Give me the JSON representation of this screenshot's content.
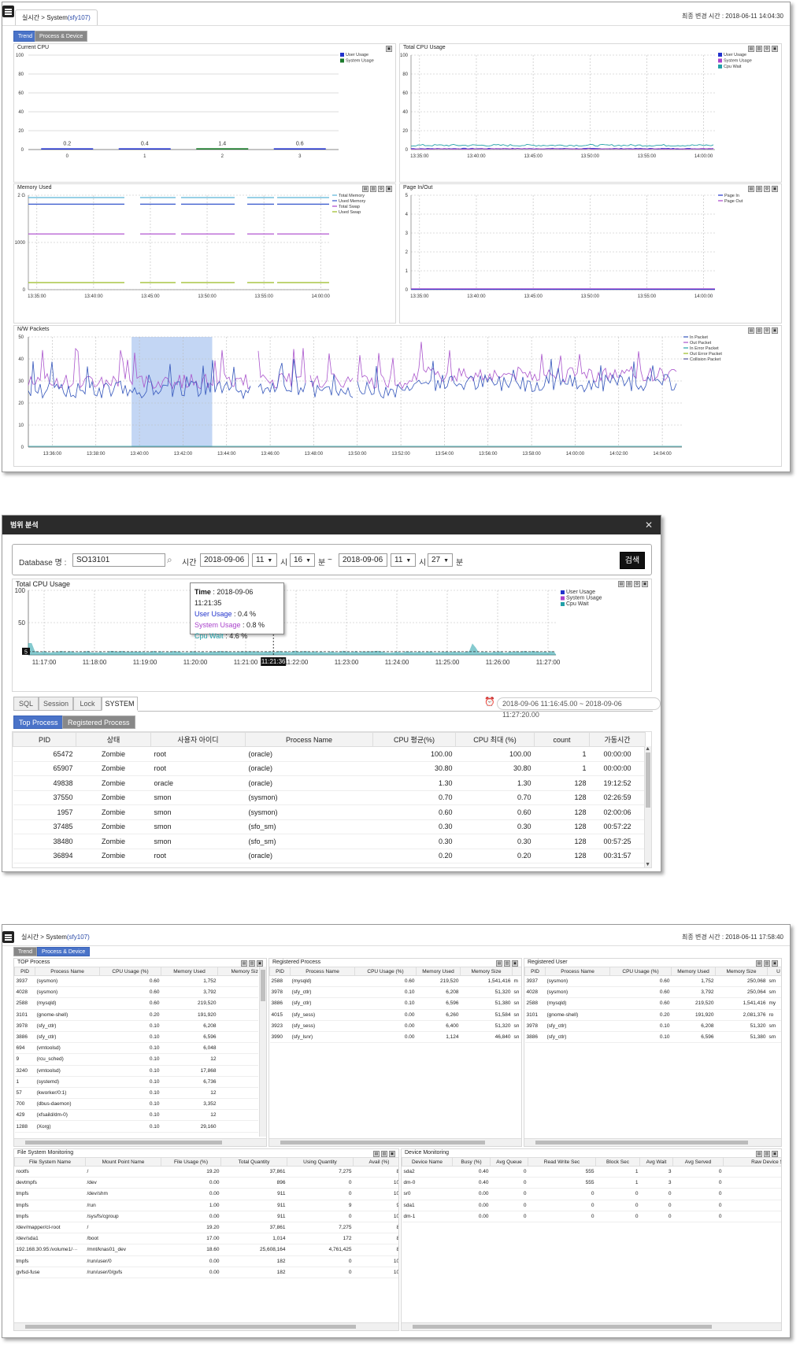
{
  "p1": {
    "breadcrumb": "실시간 > System",
    "server": "(sfy107)",
    "update_time": "최종 변경 시간 : 2018-06-11 14:04:30",
    "tabs": [
      "Trend",
      "Process & Device"
    ]
  },
  "charts1": {
    "current_cpu": {
      "type": "bar",
      "title": "Current CPU",
      "categories": [
        "0",
        "1",
        "2",
        "3"
      ],
      "series": [
        {
          "name": "User Usage",
          "values": [
            0.2,
            0.4,
            1.4,
            0.6
          ]
        },
        {
          "name": "System Usage",
          "values": [
            0,
            0,
            0,
            0
          ]
        }
      ],
      "data_labels": [
        "0.2",
        "0.4",
        "1.4",
        "0.6"
      ],
      "yticks": [
        "100",
        "80",
        "60",
        "40",
        "20",
        "0"
      ],
      "ylim": [
        0,
        100
      ],
      "legend": [
        "User Usage",
        "System Usage"
      ],
      "colors": [
        "#2233cc",
        "#1a7a2a"
      ]
    },
    "total_cpu": {
      "type": "line",
      "title": "Total CPU Usage",
      "yticks": [
        "100",
        "80",
        "60",
        "40",
        "20",
        "0"
      ],
      "xticks": [
        "13:35:00",
        "13:40:00",
        "13:45:00",
        "13:50:00",
        "13:55:00",
        "14:00:00"
      ],
      "legend": [
        "User Usage",
        "System Usage",
        "Cpu Wait"
      ],
      "colors": [
        "#2233cc",
        "#aa44cc",
        "#22a0a8"
      ],
      "ylim": [
        0,
        100
      ],
      "values_approx": [
        1,
        0.8,
        4.5
      ]
    },
    "memory": {
      "type": "line",
      "title": "Memory Used",
      "yticks": [
        "2 G",
        "1000",
        "0"
      ],
      "xticks": [
        "13:35:00",
        "13:40:00",
        "13:45:00",
        "13:50:00",
        "13:55:00",
        "14:00:00"
      ],
      "legend": [
        "Total Memory",
        "Used Memory",
        "Total Swap",
        "Used Swap"
      ],
      "colors": [
        "#5ab4d8",
        "#3355cc",
        "#aa44cc",
        "#99bb22"
      ],
      "values_approx": [
        1950,
        1810,
        1180,
        150
      ]
    },
    "page": {
      "type": "line",
      "title": "Page In/Out",
      "yticks": [
        "5",
        "4",
        "3",
        "2",
        "1",
        "0"
      ],
      "xticks": [
        "13:35:00",
        "13:40:00",
        "13:45:00",
        "13:50:00",
        "13:55:00",
        "14:00:00"
      ],
      "legend": [
        "Page In",
        "Page Out"
      ],
      "colors": [
        "#2233cc",
        "#aa44cc"
      ],
      "values_approx": [
        0,
        0
      ]
    },
    "nw": {
      "type": "line",
      "title": "N/W Packets",
      "yticks": [
        "50",
        "40",
        "30",
        "20",
        "10",
        "0"
      ],
      "xticks": [
        "13:36:00",
        "13:38:00",
        "13:40:00",
        "13:42:00",
        "13:44:00",
        "13:46:00",
        "13:48:00",
        "13:50:00",
        "13:52:00",
        "13:54:00",
        "13:56:00",
        "13:58:00",
        "14:00:00",
        "14:02:00",
        "14:04:00"
      ],
      "legend": [
        "In Packet",
        "Out Packet",
        "In Error Packet",
        "Out Error Packet",
        "Collision Packet"
      ],
      "colors": [
        "#3355bb",
        "#aa55cc",
        "#22a0a8",
        "#99bb22",
        "#555599"
      ],
      "ylim": [
        0,
        50
      ],
      "selection_range": [
        "13:40:00",
        "13:43:20"
      ]
    }
  },
  "p2": {
    "title": "범위 분석",
    "close": "✕",
    "db_label": "Database 명 :",
    "db_value": "SO13101",
    "time_label": "시간",
    "date_from": "2018-09-06",
    "hour_from": "11",
    "min_from": "16",
    "date_to": "2018-09-06",
    "hour_to": "11",
    "min_to": "27",
    "unit_h": "시",
    "unit_m": "분",
    "tilde": "~",
    "search_btn": "검색",
    "chart_title": "Total CPU Usage",
    "tooltip": {
      "time_label": "Time",
      "time": "2018-09-06 11:21:35",
      "user_label": "User Usage",
      "user": "0.4 %",
      "system_label": "System Usage",
      "system": "0.8 %",
      "wait_label": "Cpu Wait",
      "wait": "4.6 %"
    },
    "cursor_label": "11:21:36",
    "yticks": [
      "100",
      "50"
    ],
    "ymark": "5",
    "xticks": [
      "11:17:00",
      "11:18:00",
      "11:19:00",
      "11:20:00",
      "11:21:00",
      "11:22:00",
      "11:23:00",
      "11:24:00",
      "11:25:00",
      "11:26:00",
      "11:27:00"
    ],
    "legend": [
      "User Usage",
      "System Usage",
      "Cpu Wait"
    ],
    "colors": [
      "#2233cc",
      "#aa44cc",
      "#22a0a8"
    ],
    "subtabs": [
      "SQL",
      "Session",
      "Lock",
      "SYSTEM"
    ],
    "range": "2018-09-06 11:16:45.00 ~ 2018-09-06 11:27:20.00",
    "proc_tabs": [
      "Top Process",
      "Registered Process"
    ],
    "headers": [
      "PID",
      "상태",
      "사용자 아이디",
      "Process Name",
      "CPU 평균(%)",
      "CPU 최대 (%)",
      "count",
      "가동시간"
    ],
    "rows": [
      [
        "65472",
        "Zombie",
        "root",
        "(oracle)",
        "100.00",
        "100.00",
        "1",
        "00:00:00"
      ],
      [
        "65907",
        "Zombie",
        "root",
        "(oracle)",
        "30.80",
        "30.80",
        "1",
        "00:00:00"
      ],
      [
        "49838",
        "Zombie",
        "oracle",
        "(oracle)",
        "1.30",
        "1.30",
        "128",
        "19:12:52"
      ],
      [
        "37550",
        "Zombie",
        "smon",
        "(sysmon)",
        "0.70",
        "0.70",
        "128",
        "02:26:59"
      ],
      [
        "1957",
        "Zombie",
        "smon",
        "(sysmon)",
        "0.60",
        "0.60",
        "128",
        "02:00:06"
      ],
      [
        "37485",
        "Zombie",
        "smon",
        "(sfo_sm)",
        "0.30",
        "0.30",
        "128",
        "00:57:22"
      ],
      [
        "38480",
        "Zombie",
        "smon",
        "(sfo_sm)",
        "0.30",
        "0.30",
        "128",
        "00:57:25"
      ],
      [
        "36894",
        "Zombie",
        "root",
        "(oracle)",
        "0.20",
        "0.20",
        "128",
        "00:31:57"
      ]
    ]
  },
  "p3": {
    "breadcrumb": "실시간 > System",
    "server": "(sfy107)",
    "update_time": "최종 변경 시간 : 2018-06-11 17:58:40",
    "tabs": [
      "Trend",
      "Process & Device"
    ],
    "top": {
      "title": "TOP Process",
      "headers": [
        "PID",
        "Process Name",
        "CPU Usage (%)",
        "Memory Used",
        "Memory Size"
      ],
      "rows": [
        [
          "3937",
          "(sysmon)",
          "0.60",
          "1,752",
          "2"
        ],
        [
          "4028",
          "(sysmon)",
          "0.60",
          "3,792",
          "2"
        ],
        [
          "2588",
          "(mysqld)",
          "0.60",
          "219,520",
          "1,5"
        ],
        [
          "3101",
          "(gnome-shell)",
          "0.20",
          "191,920",
          "2,0"
        ],
        [
          "3978",
          "(sfy_ctlr)",
          "0.10",
          "6,208",
          "5"
        ],
        [
          "3886",
          "(sfy_ctlr)",
          "0.10",
          "6,596",
          "5"
        ],
        [
          "694",
          "(vmtoolsd)",
          "0.10",
          "6,048",
          "2"
        ],
        [
          "9",
          "(rcu_sched)",
          "0.10",
          "12",
          ""
        ],
        [
          "3240",
          "(vmtoolsd)",
          "0.10",
          "17,868",
          "3"
        ],
        [
          "1",
          "(systemd)",
          "0.10",
          "6,736",
          "1"
        ],
        [
          "57",
          "(kworker/0:1)",
          "0.10",
          "12",
          ""
        ],
        [
          "700",
          "(dbus-daemon)",
          "0.10",
          "3,352",
          ""
        ],
        [
          "429",
          "(xfsaild/dm-0)",
          "0.10",
          "12",
          ""
        ],
        [
          "1288",
          "(Xorg)",
          "0.10",
          "29,160",
          "2"
        ]
      ]
    },
    "reg": {
      "title": "Registered Process",
      "headers": [
        "PID",
        "Process Name",
        "CPU Usage (%)",
        "Memory Used",
        "Memory Size",
        ""
      ],
      "rows": [
        [
          "2588",
          "(mysqld)",
          "0.60",
          "219,520",
          "1,541,416",
          "m"
        ],
        [
          "3978",
          "(sfy_ctlr)",
          "0.10",
          "6,208",
          "51,320",
          "sn"
        ],
        [
          "3886",
          "(sfy_ctlr)",
          "0.10",
          "6,596",
          "51,380",
          "sn"
        ],
        [
          "4015",
          "(sfy_sess)",
          "0.00",
          "6,260",
          "51,584",
          "sn"
        ],
        [
          "3923",
          "(sfy_sess)",
          "0.00",
          "6,400",
          "51,320",
          "sn"
        ],
        [
          "3990",
          "(sfy_lsnr)",
          "0.00",
          "1,124",
          "46,840",
          "sn"
        ]
      ]
    },
    "user": {
      "title": "Registered User",
      "headers": [
        "PID",
        "Process Name",
        "CPU Usage (%)",
        "Memory Used",
        "Memory Size",
        "U"
      ],
      "rows": [
        [
          "3937",
          "(sysmon)",
          "0.60",
          "1,752",
          "250,068",
          "sm"
        ],
        [
          "4028",
          "(sysmon)",
          "0.60",
          "3,792",
          "250,064",
          "sm"
        ],
        [
          "2588",
          "(mysqld)",
          "0.60",
          "219,520",
          "1,541,416",
          "my"
        ],
        [
          "3101",
          "(gnome-shell)",
          "0.20",
          "191,920",
          "2,081,376",
          "ro"
        ],
        [
          "3978",
          "(sfy_ctlr)",
          "0.10",
          "6,208",
          "51,320",
          "sm"
        ],
        [
          "3886",
          "(sfy_ctlr)",
          "0.10",
          "6,596",
          "51,380",
          "sm"
        ]
      ]
    },
    "fs": {
      "title": "File System Monitoring",
      "headers": [
        "File System Name",
        "Mount Point Name",
        "File Usage (%)",
        "Total Quantity",
        "Using Quantity",
        "Avail (%)"
      ],
      "rows": [
        [
          "rootfs",
          "/",
          "19.20",
          "37,861",
          "7,275",
          "80."
        ],
        [
          "devtmpfs",
          "/dev",
          "0.00",
          "896",
          "0",
          "100."
        ],
        [
          "tmpfs",
          "/dev/shm",
          "0.00",
          "911",
          "0",
          "100."
        ],
        [
          "tmpfs",
          "/run",
          "1.00",
          "911",
          "9",
          "99."
        ],
        [
          "tmpfs",
          "/sys/fs/cgroup",
          "0.00",
          "911",
          "0",
          "100."
        ],
        [
          "/dev/mapper/cl-root",
          "/",
          "19.20",
          "37,861",
          "7,275",
          "80."
        ],
        [
          "/dev/sda1",
          "/boot",
          "17.00",
          "1,014",
          "172",
          "83."
        ],
        [
          "192.168.30.95:/volume1/···",
          "/mnt/knas01_dev",
          "18.60",
          "25,608,164",
          "4,761,425",
          "81."
        ],
        [
          "tmpfs",
          "/run/user/0",
          "0.00",
          "182",
          "0",
          "100."
        ],
        [
          "gvfsd-fuse",
          "/run/user/0/gvfs",
          "0.00",
          "182",
          "0",
          "100."
        ]
      ]
    },
    "dev": {
      "title": "Device Monitoring",
      "headers": [
        "Device Name",
        "Busy (%)",
        "Avg Queue",
        "Read Write Sec",
        "Block Sec",
        "Avg Wait",
        "Avg Served",
        "Raw Device S"
      ],
      "rows": [
        [
          "sda2",
          "0.40",
          "0",
          "555",
          "1",
          "3",
          "0",
          ""
        ],
        [
          "dm-0",
          "0.40",
          "0",
          "555",
          "1",
          "3",
          "0",
          ""
        ],
        [
          "sr0",
          "0.00",
          "0",
          "0",
          "0",
          "0",
          "0",
          ""
        ],
        [
          "sda1",
          "0.00",
          "0",
          "0",
          "0",
          "0",
          "0",
          ""
        ],
        [
          "dm-1",
          "0.00",
          "0",
          "0",
          "0",
          "0",
          "0",
          ""
        ]
      ]
    }
  }
}
